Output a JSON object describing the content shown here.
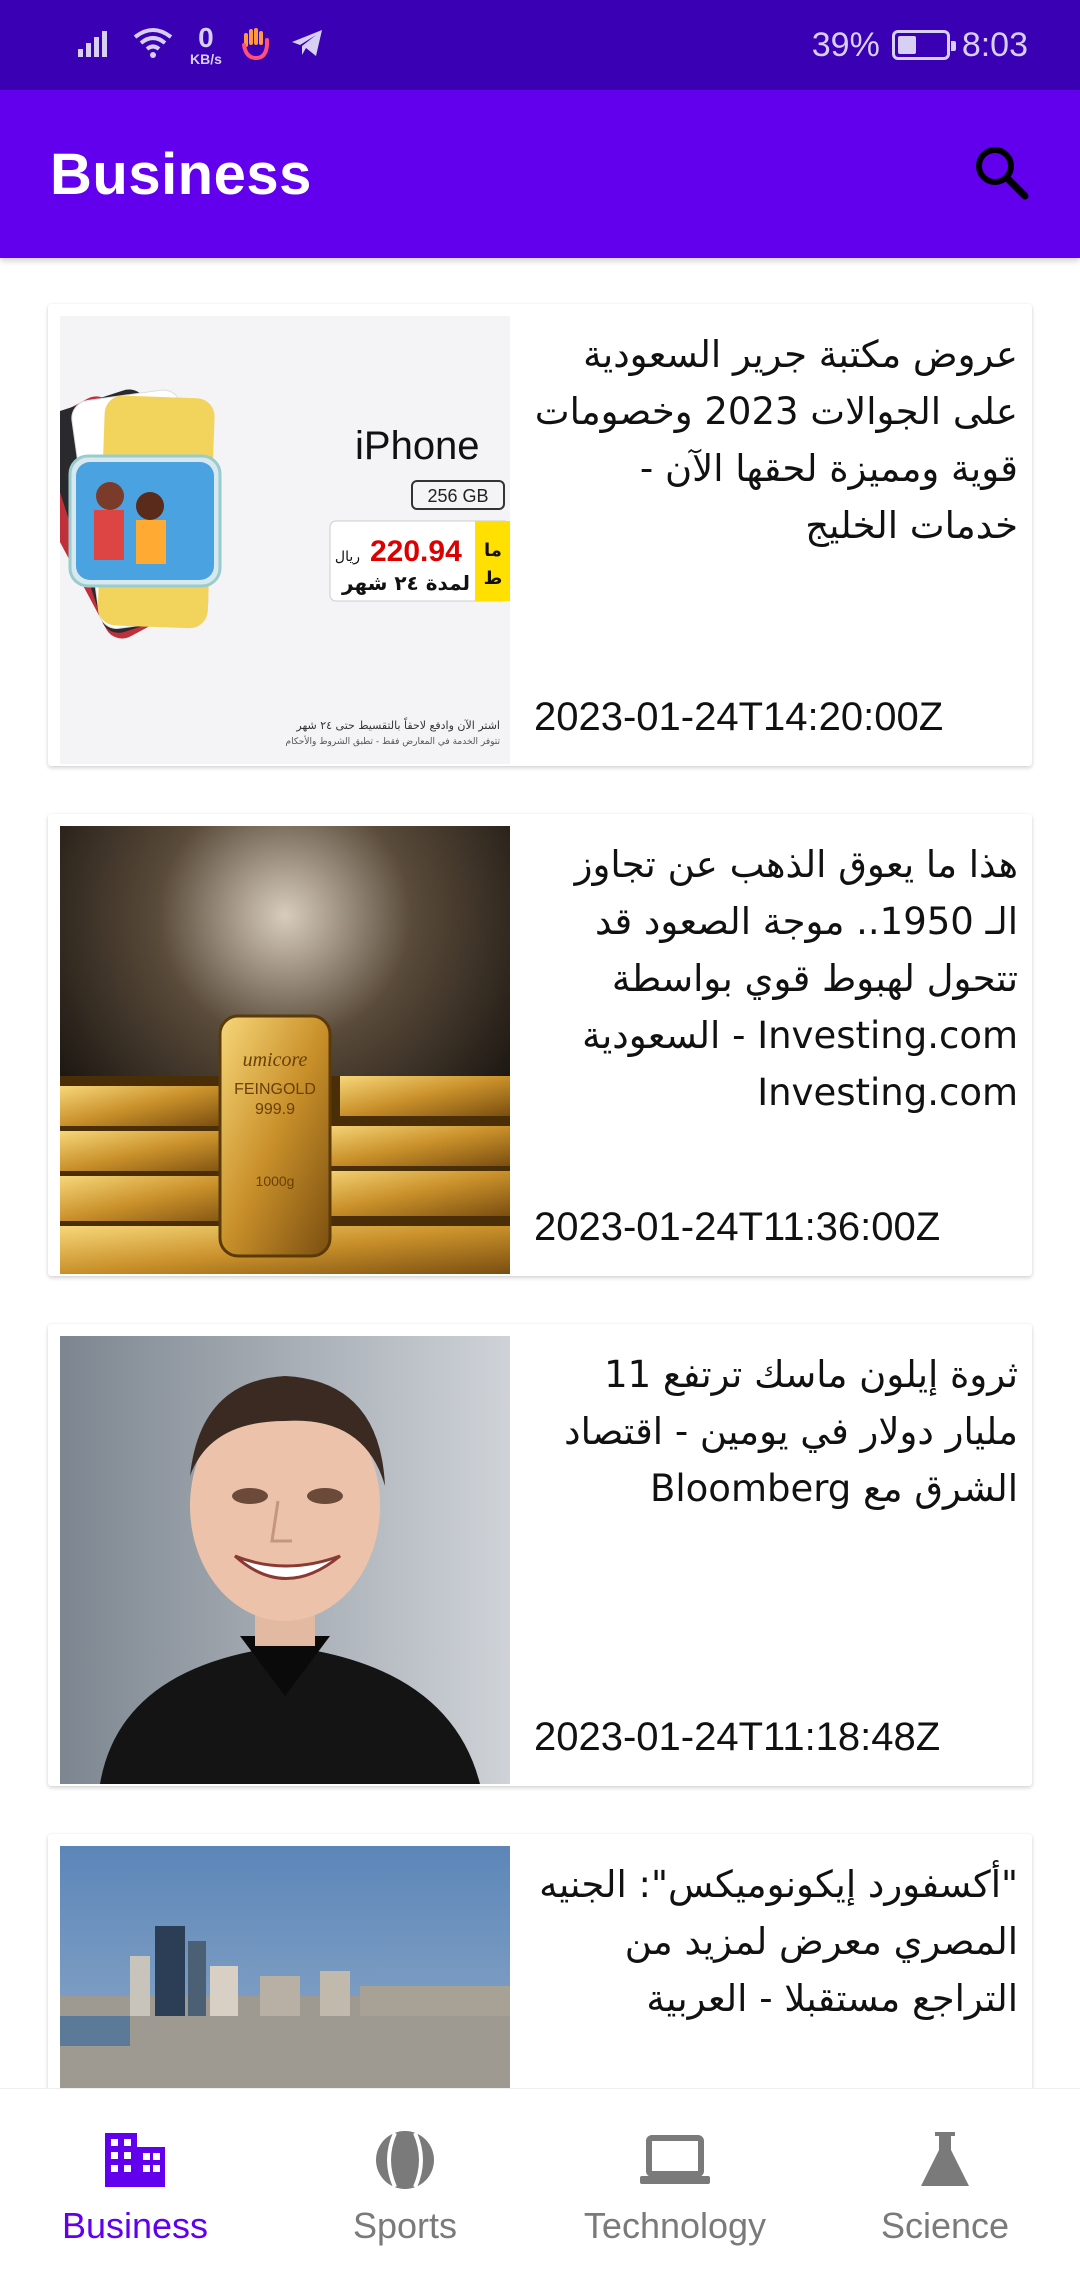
{
  "status_bar": {
    "speed_value": "0",
    "speed_unit": "KB/s",
    "battery_percent": "39%",
    "battery_level": 0.39,
    "time": "8:03",
    "icons": [
      "signal-icon",
      "wifi-icon",
      "hand-app-icon",
      "telegram-icon"
    ]
  },
  "app_bar": {
    "title": "Business",
    "search_icon": "search-icon"
  },
  "articles": [
    {
      "title": "عروض مكتبة جرير السعودية على الجوالات 2023 وخصومات قوية ومميزة لحقها الآن - خدمات الخليج",
      "date": "2023-01-24T14:20:00Z",
      "image": "iphone-promo-image",
      "image_text": {
        "brand": "iPhone",
        "storage": "256 GB",
        "price": "220.94",
        "currency": "ريال",
        "installment": "لمدة ٢٤ شهر",
        "tag_top": "ما",
        "tag_bottom": "ط",
        "fine_print_1": "اشتر الآن وادفع لاحقاً بالتقسيط حتى ٢٤ شهر",
        "fine_print_2": "تتوفر الخدمة في المعارض فقط - تطبق الشروط والأحكام"
      }
    },
    {
      "title": "هذا ما يعوق الذهب عن تجاوز الـ 1950.. موجة الصعود قد تتحول لهبوط قوي بواسطة Investing.com - السعودية Investing.com",
      "date": "2023-01-24T11:36:00Z",
      "image": "gold-bars-image",
      "image_text": {
        "brand": "umicore",
        "line1": "FEINGOLD",
        "line2": "999.9",
        "line3": "1000g"
      }
    },
    {
      "title": "ثروة إيلون ماسك ترتفع 11 مليار دولار في يومين - اقتصاد الشرق مع Bloomberg",
      "date": "2023-01-24T11:18:48Z",
      "image": "portrait-photo-image"
    },
    {
      "title": "\"أكسفورد إيكونوميكس\": الجنيه المصري معرض لمزيد من التراجع مستقبلا - العربية",
      "date": "",
      "image": "city-skyline-image"
    }
  ],
  "bottom_nav": {
    "active": "business",
    "items": [
      {
        "label": "Business",
        "icon": "building-icon"
      },
      {
        "label": "Sports",
        "icon": "ball-icon"
      },
      {
        "label": "Technology",
        "icon": "laptop-icon"
      },
      {
        "label": "Science",
        "icon": "flask-icon"
      }
    ]
  },
  "colors": {
    "status_bar": "#3a00b3",
    "primary": "#6200ee",
    "nav_inactive": "#7a7a7a"
  }
}
